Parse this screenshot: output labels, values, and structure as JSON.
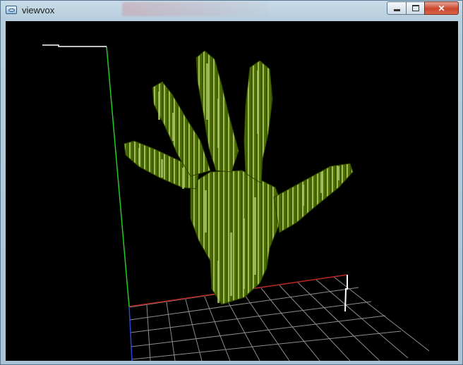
{
  "window": {
    "title": "viewvox",
    "close_glyph": "✕"
  },
  "icons": [
    "app-icon",
    "minimize-icon",
    "maximize-icon",
    "close-icon"
  ],
  "colors": {
    "background": "#000000",
    "voxel_face": "#4a6b00",
    "voxel_highlight": "#a6c261",
    "x_axis": "#b02020",
    "y_axis": "#20c020",
    "z_axis": "#2040d0",
    "grid": "#9a9a9a"
  }
}
